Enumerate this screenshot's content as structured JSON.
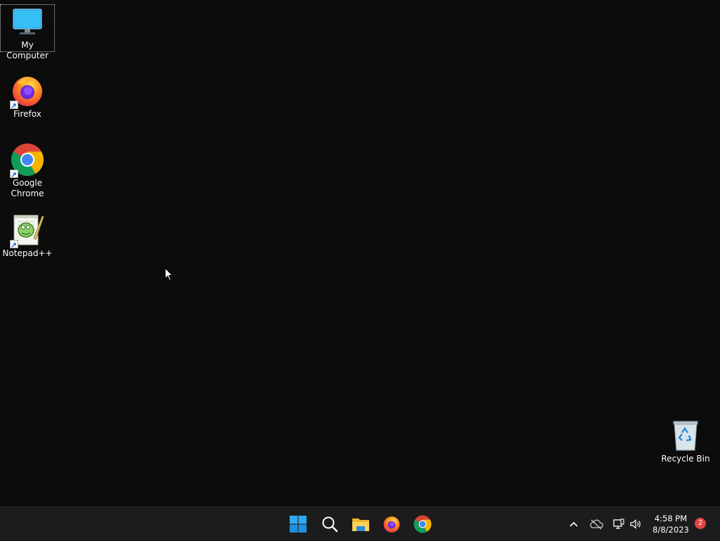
{
  "desktop": {
    "icons": [
      {
        "label": "My Computer"
      },
      {
        "label": "Firefox"
      },
      {
        "label": "Google Chrome"
      },
      {
        "label": "Notepad++"
      },
      {
        "label": "Recycle Bin"
      }
    ]
  },
  "taskbar": {
    "pinned": [
      {
        "name": "start-icon"
      },
      {
        "name": "search-icon"
      },
      {
        "name": "file-explorer-icon"
      },
      {
        "name": "firefox-icon"
      },
      {
        "name": "chrome-icon"
      }
    ],
    "tray": {
      "icons": [
        "chevron-up-icon",
        "onedrive-offline-icon",
        "network-icon",
        "volume-icon"
      ],
      "time": "4:58 PM",
      "date": "8/8/2023",
      "notification_count": "2"
    }
  },
  "colors": {
    "desktop_bg": "#0c0c0c",
    "taskbar_bg": "#1c1c1c",
    "start_blue": "#1f9ff0",
    "badge_red": "#e0453f"
  }
}
